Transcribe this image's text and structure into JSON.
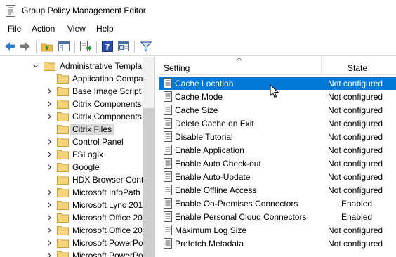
{
  "window": {
    "title": "Group Policy Management Editor"
  },
  "menu": {
    "items": [
      "File",
      "Action",
      "View",
      "Help"
    ]
  },
  "toolbar": {
    "buttons": [
      "back-icon",
      "forward-icon",
      "folder-up-icon",
      "show-hide-tree-icon",
      "export-list-icon",
      "help-icon",
      "console-tree-icon",
      "filter-icon"
    ]
  },
  "tree": {
    "items": [
      {
        "label": "Administrative Templa",
        "expanded": true,
        "level": 0
      },
      {
        "label": "Application Compa",
        "level": 1,
        "has_children": false
      },
      {
        "label": "Base Image Script F",
        "level": 1,
        "has_children": true
      },
      {
        "label": "Citrix Components",
        "level": 1,
        "has_children": true
      },
      {
        "label": "Citrix Components",
        "level": 1,
        "has_children": true
      },
      {
        "label": "Citrix Files",
        "level": 1,
        "has_children": false,
        "selected": true
      },
      {
        "label": "Control Panel",
        "level": 1,
        "has_children": true
      },
      {
        "label": "FSLogix",
        "level": 1,
        "has_children": true
      },
      {
        "label": "Google",
        "level": 1,
        "has_children": true
      },
      {
        "label": "HDX Browser Conte",
        "level": 1,
        "has_children": false
      },
      {
        "label": "Microsoft InfoPath",
        "level": 1,
        "has_children": true
      },
      {
        "label": "Microsoft Lync 201",
        "level": 1,
        "has_children": true
      },
      {
        "label": "Microsoft Office 20",
        "level": 1,
        "has_children": true
      },
      {
        "label": "Microsoft Office 20",
        "level": 1,
        "has_children": true
      },
      {
        "label": "Microsoft PowerPo",
        "level": 1,
        "has_children": true
      },
      {
        "label": "Microsoft PowerPo",
        "level": 1,
        "has_children": true
      }
    ]
  },
  "list": {
    "columns": {
      "setting": "Setting",
      "state": "State"
    },
    "rows": [
      {
        "setting": "Cache Location",
        "state": "Not configured",
        "selected": true
      },
      {
        "setting": "Cache Mode",
        "state": "Not configured"
      },
      {
        "setting": "Cache Size",
        "state": "Not configured"
      },
      {
        "setting": "Delete Cache on Exit",
        "state": "Not configured"
      },
      {
        "setting": "Disable Tutorial",
        "state": "Not configured"
      },
      {
        "setting": "Enable Application",
        "state": "Not configured"
      },
      {
        "setting": "Enable Auto Check-out",
        "state": "Not configured"
      },
      {
        "setting": "Enable Auto-Update",
        "state": "Not configured"
      },
      {
        "setting": "Enable Offline Access",
        "state": "Not configured"
      },
      {
        "setting": "Enable On-Premises Connectors",
        "state": "Enabled"
      },
      {
        "setting": "Enable Personal Cloud Connectors",
        "state": "Enabled"
      },
      {
        "setting": "Maximum Log Size",
        "state": "Not configured"
      },
      {
        "setting": "Prefetch Metadata",
        "state": "Not configured"
      }
    ]
  },
  "colors": {
    "selection": "#0078d7",
    "tree_selection": "#d9d9d9",
    "folder": "#e8b94a"
  }
}
